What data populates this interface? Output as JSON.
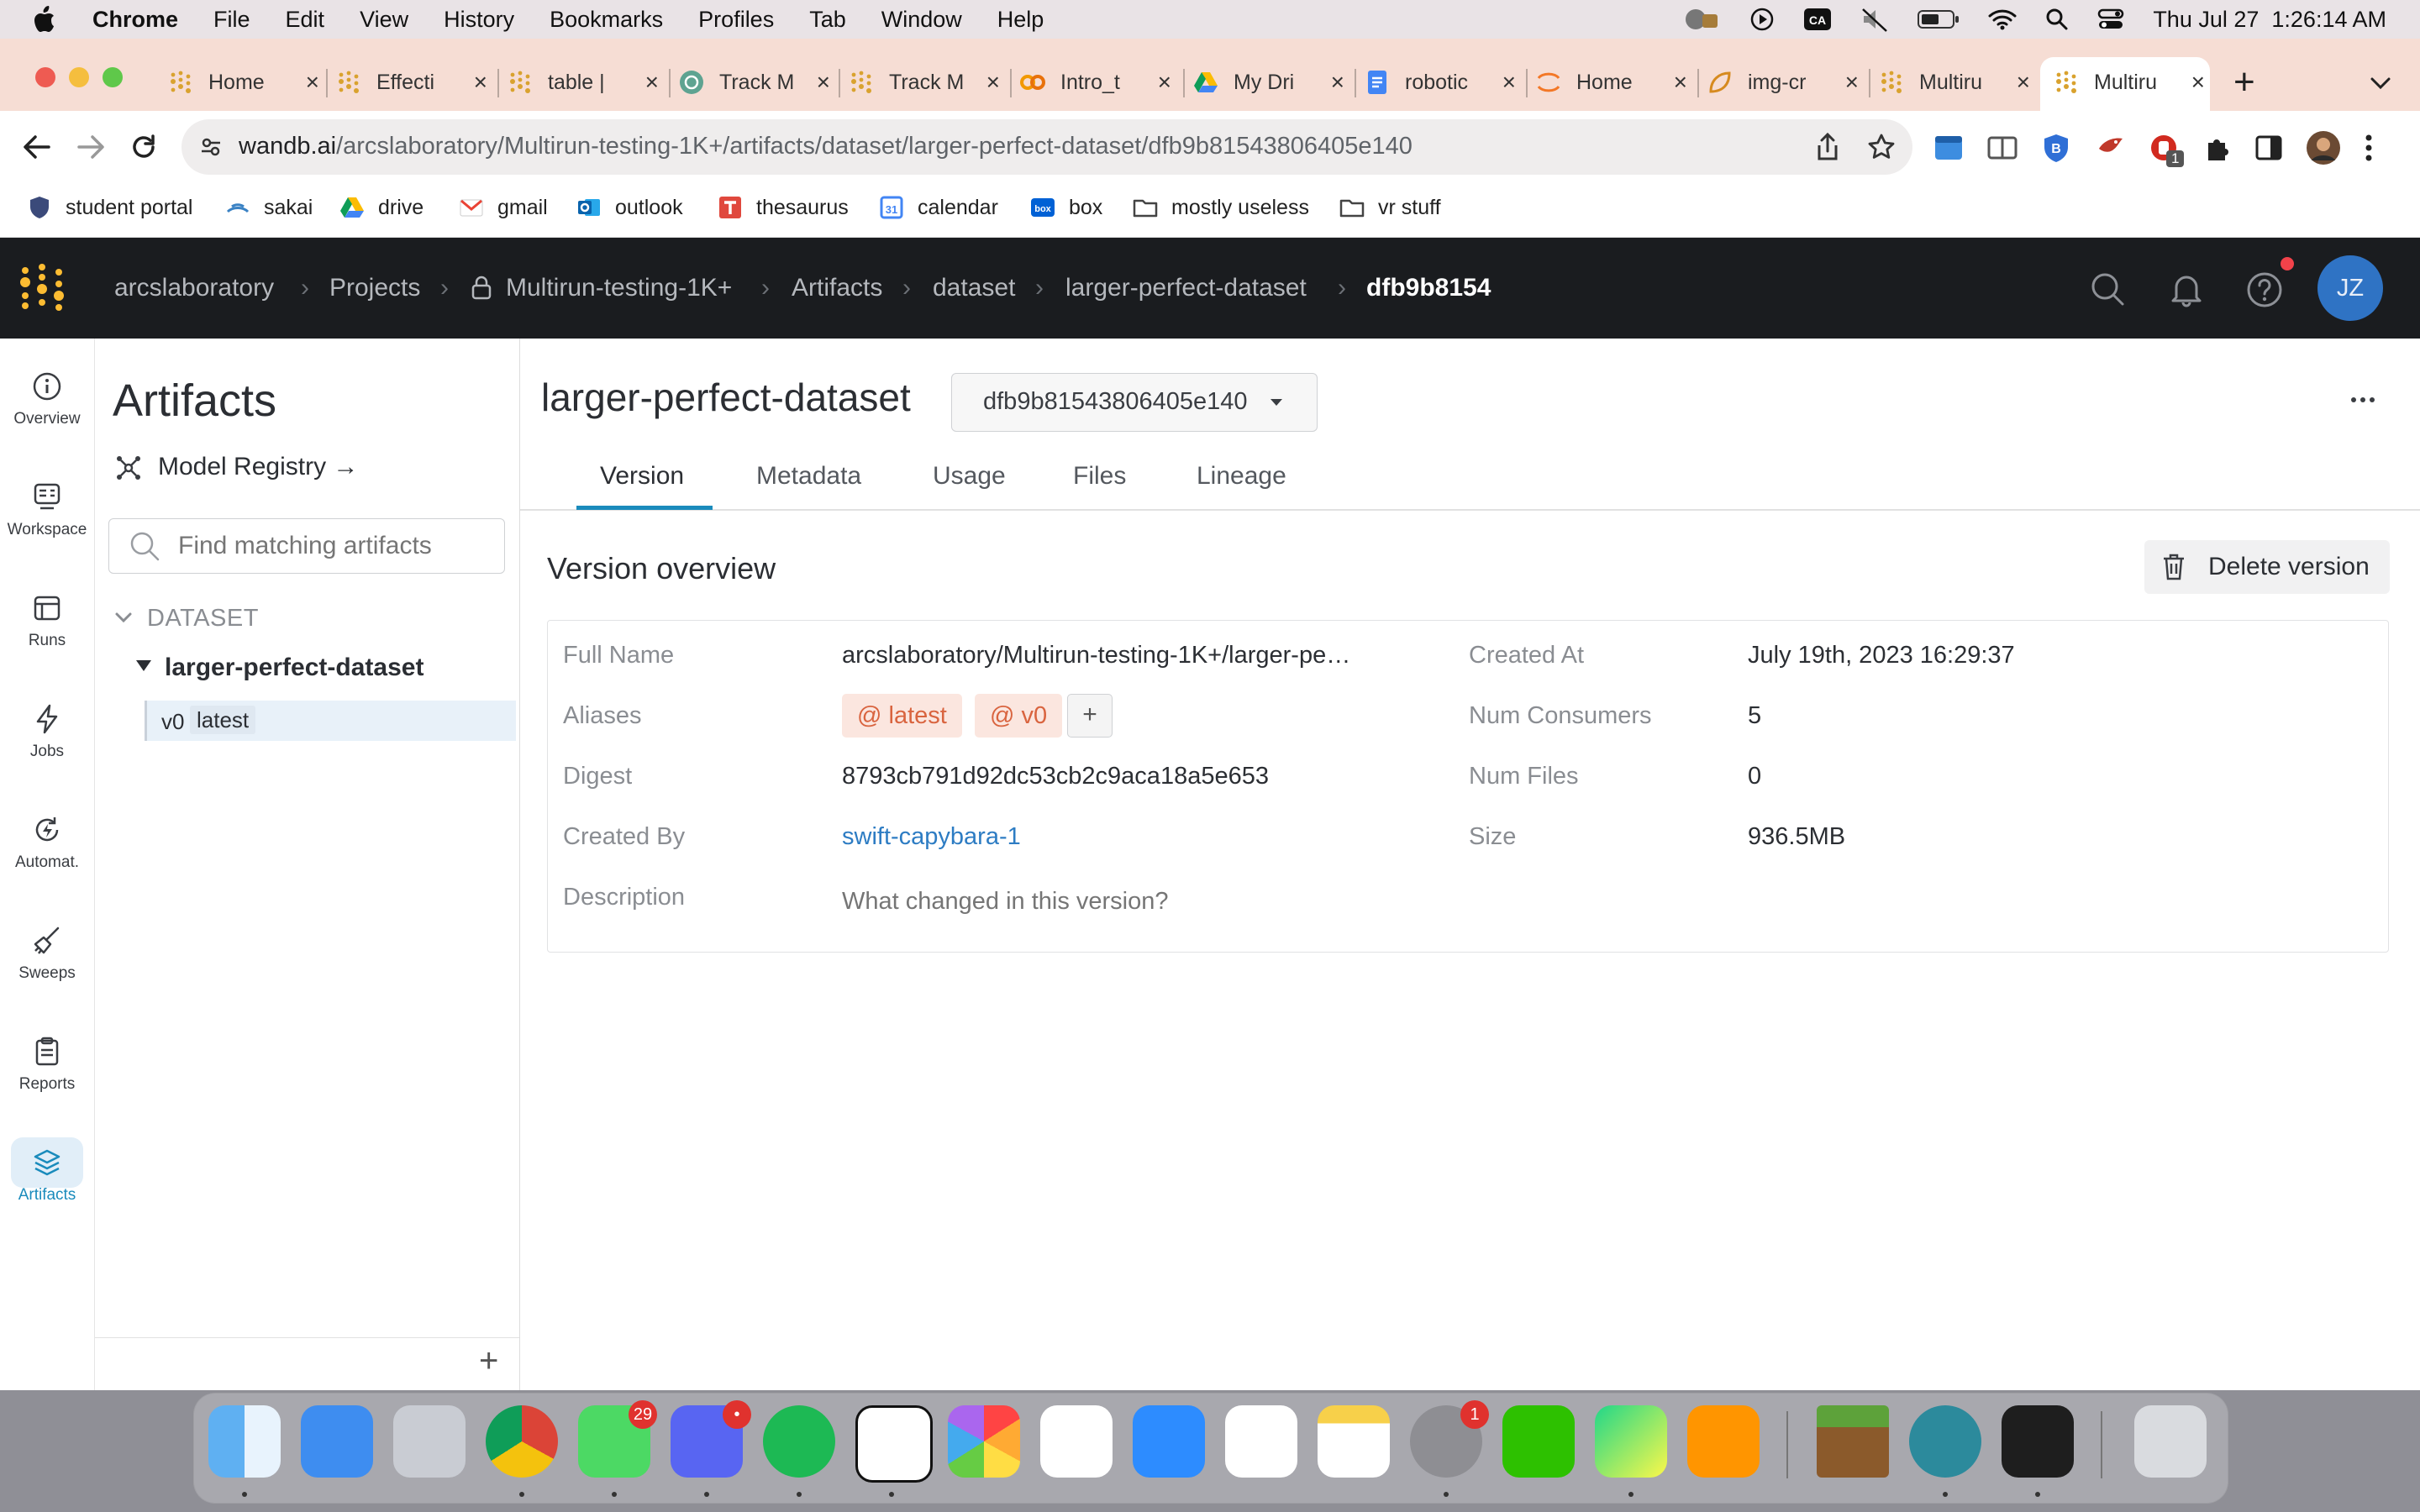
{
  "menubar": {
    "app": "Chrome",
    "items": [
      "File",
      "Edit",
      "View",
      "History",
      "Bookmarks",
      "Profiles",
      "Tab",
      "Window",
      "Help"
    ],
    "clock": "Thu Jul 27  1:26:14 AM"
  },
  "tabs": [
    {
      "title": "Home",
      "icon": "wandb-icon"
    },
    {
      "title": "Effecti",
      "icon": "wandb-icon"
    },
    {
      "title": "table |",
      "icon": "wandb-icon"
    },
    {
      "title": "Track M",
      "icon": "chatgpt-icon"
    },
    {
      "title": "Track M",
      "icon": "wandb-icon"
    },
    {
      "title": "Intro_t",
      "icon": "colab-icon"
    },
    {
      "title": "My Dri",
      "icon": "google-drive-icon"
    },
    {
      "title": "robotic",
      "icon": "google-docs-icon"
    },
    {
      "title": "Home",
      "icon": "jupyter-icon"
    },
    {
      "title": "img-cr",
      "icon": "overleaf-icon"
    },
    {
      "title": "Multiru",
      "icon": "wandb-icon"
    },
    {
      "title": "Multiru",
      "icon": "wandb-icon",
      "active": true
    }
  ],
  "address": {
    "host": "wandb.ai",
    "path": "/arcslaboratory/Multirun-testing-1K+/artifacts/dataset/larger-perfect-dataset/dfb9b81543806405e140"
  },
  "bookmarks": [
    {
      "label": "student portal",
      "icon": "shield-icon"
    },
    {
      "label": "sakai",
      "icon": "sakai-icon"
    },
    {
      "label": "drive",
      "icon": "google-drive-icon"
    },
    {
      "label": "gmail",
      "icon": "gmail-icon"
    },
    {
      "label": "outlook",
      "icon": "outlook-icon"
    },
    {
      "label": "thesaurus",
      "icon": "thesaurus-icon"
    },
    {
      "label": "calendar",
      "icon": "calendar-icon"
    },
    {
      "label": "box",
      "icon": "box-icon"
    },
    {
      "label": "mostly useless",
      "icon": "folder-icon"
    },
    {
      "label": "vr stuff",
      "icon": "folder-icon"
    }
  ],
  "breadcrumbs": [
    "arcslaboratory",
    "Projects",
    "Multirun-testing-1K+",
    "Artifacts",
    "dataset",
    "larger-perfect-dataset",
    "dfb9b8154"
  ],
  "user": {
    "initials": "JZ"
  },
  "rail": [
    {
      "label": "Overview",
      "icon": "info-icon"
    },
    {
      "label": "Workspace",
      "icon": "workspace-icon"
    },
    {
      "label": "Runs",
      "icon": "table-icon"
    },
    {
      "label": "Jobs",
      "icon": "bolt-icon"
    },
    {
      "label": "Automat.",
      "icon": "automation-icon"
    },
    {
      "label": "Sweeps",
      "icon": "broom-icon"
    },
    {
      "label": "Reports",
      "icon": "clipboard-icon"
    },
    {
      "label": "Artifacts",
      "icon": "layers-icon",
      "active": true
    }
  ],
  "artifacts_panel": {
    "title": "Artifacts",
    "registry_link": "Model Registry →",
    "search_placeholder": "Find matching artifacts",
    "group": "DATASET",
    "artifact": "larger-perfect-dataset",
    "version": "v0",
    "version_alias": "latest"
  },
  "main": {
    "artifact_name": "larger-perfect-dataset",
    "version_select": "dfb9b81543806405e140",
    "tabs": [
      "Version",
      "Metadata",
      "Usage",
      "Files",
      "Lineage"
    ],
    "active_tab": "Version",
    "section_title": "Version overview",
    "delete_label": "Delete version",
    "left_fields": {
      "full_name_label": "Full Name",
      "full_name": "arcslaboratory/Multirun-testing-1K+/larger-pe…",
      "aliases_label": "Aliases",
      "aliases": [
        "latest",
        "v0"
      ],
      "digest_label": "Digest",
      "digest": "8793cb791d92dc53cb2c9aca18a5e653",
      "created_by_label": "Created By",
      "created_by": "swift-capybara-1",
      "description_label": "Description",
      "description_placeholder": "What changed in this version?"
    },
    "right_fields": {
      "created_at_label": "Created At",
      "created_at": "July 19th, 2023 16:29:37",
      "consumers_label": "Num Consumers",
      "consumers": "5",
      "files_label": "Num Files",
      "files": "0",
      "size_label": "Size",
      "size": "936.5MB"
    }
  },
  "dock": {
    "messages_badge": "29",
    "discord_badge": "•",
    "settings_badge": "1",
    "extension_badge": "1"
  },
  "colors": {
    "wandb_gold": "#fcbc32",
    "link_blue": "#2d7cc3",
    "alias_bg": "#fbe6df",
    "alias_text": "#d9643f",
    "tab_active": "#1a8bbc",
    "header_bg": "#1a1c1f",
    "avatar_bg": "#2f73c4"
  }
}
